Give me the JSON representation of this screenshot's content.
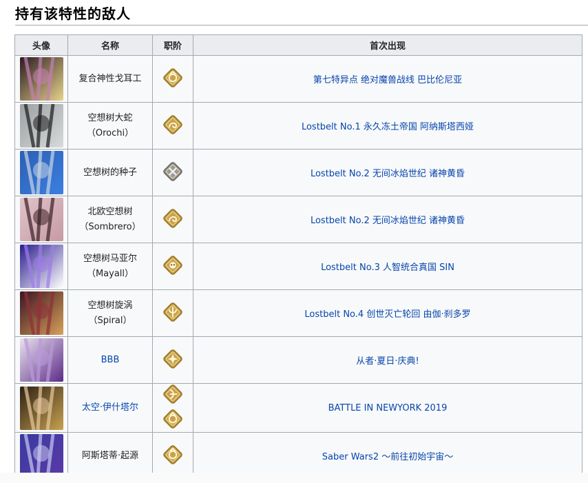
{
  "section_title": "持有该特性的敌人",
  "table": {
    "headers": [
      "头像",
      "名称",
      "职阶",
      "首次出现"
    ],
    "rows": [
      {
        "name": "复合神性戈耳工",
        "name_sub": "",
        "name_link": false,
        "classes": [
          "avenger-icon"
        ],
        "appearance": "第七特异点 绝对魔兽战线 巴比伦尼亚",
        "colors": [
          "#2a1a22",
          "#c77fb5",
          "#e6d38a"
        ]
      },
      {
        "name": "空想树大蛇",
        "name_sub": "（Orochi）",
        "name_link": false,
        "classes": [
          "foreigner-icon"
        ],
        "appearance": "Lostbelt No.1 永久冻土帝国 阿纳斯塔西娅",
        "colors": [
          "#9ba0a2",
          "#1c1c1c",
          "#d8dadb"
        ]
      },
      {
        "name": "空想树的种子",
        "name_sub": "",
        "name_link": false,
        "classes": [
          "silver-shielder-icon"
        ],
        "appearance": "Lostbelt No.2 无间冰焰世纪 诸神黄昏",
        "colors": [
          "#2c5fb4",
          "#c9d6e4",
          "#3c7fe0"
        ]
      },
      {
        "name": "北欧空想树",
        "name_sub": "（Sombrero）",
        "name_link": false,
        "classes": [
          "foreigner-icon"
        ],
        "appearance": "Lostbelt No.2 无间冰焰世纪 诸神黄昏",
        "colors": [
          "#e0c4cb",
          "#3a2226",
          "#c79aa4"
        ]
      },
      {
        "name": "空想树马亚尔",
        "name_sub": "（Mayall）",
        "name_link": false,
        "classes": [
          "beast-icon"
        ],
        "appearance": "Lostbelt No.3 人智统合真国 SIN",
        "colors": [
          "#2a1e8c",
          "#9d7ce8",
          "#ffffff"
        ]
      },
      {
        "name": "空想树旋涡",
        "name_sub": "（Spiral）",
        "name_link": false,
        "classes": [
          "alterego-icon"
        ],
        "appearance": "Lostbelt No.4 创世灭亡轮回 由伽·刹多罗",
        "colors": [
          "#3b1422",
          "#8f2f3a",
          "#d6a05a"
        ]
      },
      {
        "name": "BBB",
        "name_sub": "",
        "name_link": true,
        "classes": [
          "mooncancer-icon"
        ],
        "appearance": "从者·夏日·庆典!",
        "colors": [
          "#e9e3ef",
          "#b99ad9",
          "#5c2c88"
        ]
      },
      {
        "name": "太空·伊什塔尔",
        "name_sub": "",
        "name_link": true,
        "classes": [
          "archer-icon",
          "avenger-icon"
        ],
        "appearance": "BATTLE IN NEWYORK 2019",
        "colors": [
          "#2b2014",
          "#e8c9a0",
          "#c8a250"
        ]
      },
      {
        "name": "阿斯塔蒂·起源",
        "name_sub": "",
        "name_link": false,
        "classes": [
          "avenger-icon"
        ],
        "appearance": "Saber Wars2 ～前往初始宇宙～",
        "colors": [
          "#3a3aa0",
          "#c8c8f0",
          "#5a3aa8"
        ]
      }
    ]
  }
}
